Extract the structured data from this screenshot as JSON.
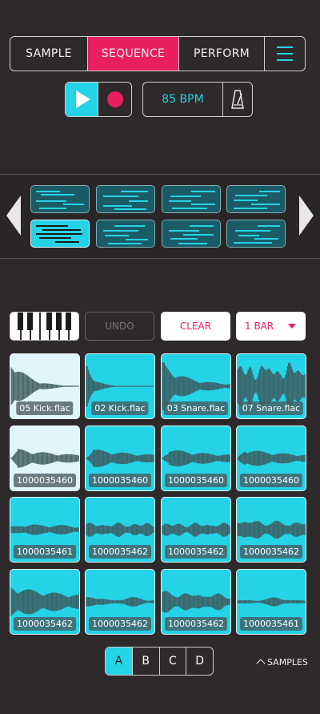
{
  "tabs": [
    {
      "label": "SAMPLE",
      "active": false
    },
    {
      "label": "SEQUENCE",
      "active": true
    },
    {
      "label": "PERFORM",
      "active": false
    }
  ],
  "menu_icon": "hamburger-icon",
  "transport": {
    "play_icon": "play-icon",
    "record_icon": "record-icon",
    "tempo": "85 BPM",
    "metronome_icon": "metronome-icon"
  },
  "patterns": {
    "count": 8,
    "selected_index": 4,
    "prev_icon": "chevron-left-icon",
    "next_icon": "chevron-right-icon"
  },
  "controls": {
    "piano_icon": "piano-keys-icon",
    "undo_label": "UNDO",
    "clear_label": "CLEAR",
    "bar_length": "1 BAR"
  },
  "pads": [
    {
      "label": "05 Kick.flac",
      "highlight": true
    },
    {
      "label": "02 Kick.flac",
      "highlight": false
    },
    {
      "label": "03 Snare.flac",
      "highlight": false
    },
    {
      "label": "07 Snare.flac",
      "highlight": false
    },
    {
      "label": "1000035460",
      "highlight": true
    },
    {
      "label": "1000035460",
      "highlight": false
    },
    {
      "label": "1000035460",
      "highlight": false
    },
    {
      "label": "1000035460",
      "highlight": false
    },
    {
      "label": "1000035461",
      "highlight": false
    },
    {
      "label": "1000035462",
      "highlight": false
    },
    {
      "label": "1000035462",
      "highlight": false
    },
    {
      "label": "1000035462",
      "highlight": false
    },
    {
      "label": "1000035462",
      "highlight": false
    },
    {
      "label": "1000035462",
      "highlight": false
    },
    {
      "label": "1000035462",
      "highlight": false
    },
    {
      "label": "1000035461",
      "highlight": false
    }
  ],
  "banks": [
    {
      "label": "A",
      "active": true
    },
    {
      "label": "B",
      "active": false
    },
    {
      "label": "C",
      "active": false
    },
    {
      "label": "D",
      "active": false
    }
  ],
  "samples_toggle": "SAMPLES",
  "colors": {
    "background": "#2e292a",
    "accent_cyan": "#25d3e6",
    "accent_pink": "#ea1f60",
    "pad_light": "#e0f6fb",
    "waveform": "#3d5a5e"
  }
}
